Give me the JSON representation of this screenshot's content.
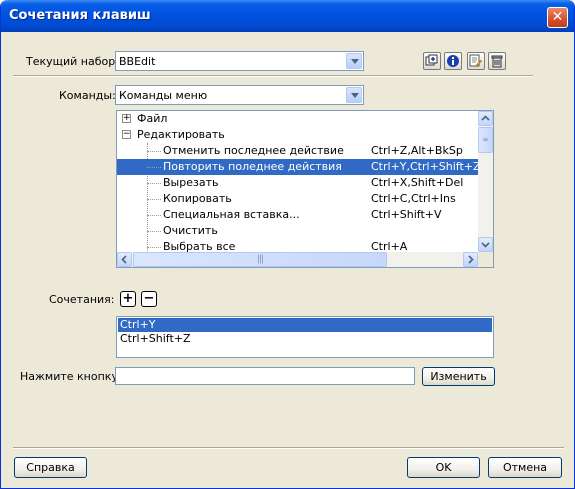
{
  "window": {
    "title": "Сочетания клавиш",
    "close_glyph": "✕"
  },
  "current_set": {
    "label": "Текущий набор:",
    "value": "BBEdit"
  },
  "toolbar_icons": [
    "duplicate-set-icon",
    "info-icon",
    "rename-icon",
    "trash-icon"
  ],
  "commands": {
    "label": "Команды:",
    "value": "Команды меню",
    "tree": [
      {
        "type": "group",
        "name": "Файл",
        "expanded": false,
        "toggle": "+"
      },
      {
        "type": "group",
        "name": "Редактировать",
        "expanded": true,
        "toggle": "−"
      },
      {
        "type": "item",
        "name": "Отменить последнее действие",
        "keys": "Ctrl+Z,Alt+BkSp"
      },
      {
        "type": "item",
        "name": "Повторить поледнее действия",
        "keys": "Ctrl+Y,Ctrl+Shift+Z",
        "selected": true
      },
      {
        "type": "item",
        "name": "Вырезать",
        "keys": "Ctrl+X,Shift+Del"
      },
      {
        "type": "item",
        "name": "Копировать",
        "keys": "Ctrl+C,Ctrl+Ins"
      },
      {
        "type": "item",
        "name": "Специальная вставка...",
        "keys": "Ctrl+Shift+V"
      },
      {
        "type": "item",
        "name": "Очистить",
        "keys": ""
      },
      {
        "type": "item",
        "name": "Выбрать все",
        "keys": "Ctrl+A"
      }
    ]
  },
  "shortcuts": {
    "label": "Сочетания:",
    "add_glyph": "+",
    "remove_glyph": "−",
    "items": [
      "Ctrl+Y",
      "Ctrl+Shift+Z"
    ]
  },
  "press_key": {
    "label": "Нажмите кнопку:",
    "value": "",
    "change_button": "Изменить"
  },
  "footer": {
    "help_button": "Справка",
    "ok_button": "OK",
    "cancel_button": "Отмена"
  },
  "colors": {
    "titlebar": "#0054e3",
    "selection": "#316ac5",
    "dialog_bg": "#ece9d8"
  }
}
